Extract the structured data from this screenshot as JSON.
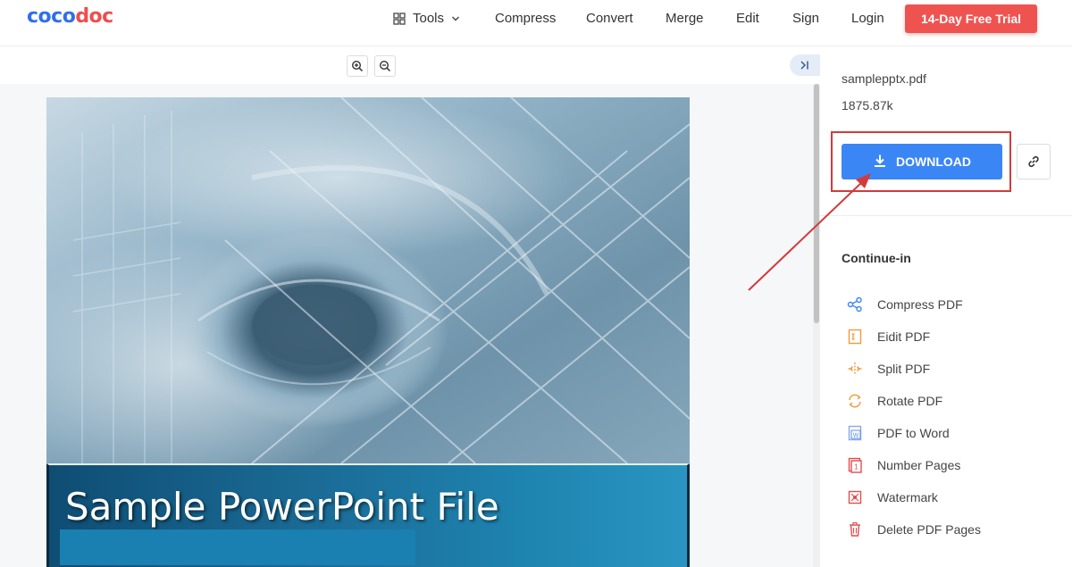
{
  "header": {
    "logo_part1": "coco",
    "logo_part2": "doc",
    "nav": {
      "tools": "Tools",
      "compress": "Compress",
      "convert": "Convert",
      "merge": "Merge",
      "edit": "Edit",
      "sign": "Sign",
      "login": "Login"
    },
    "trial_button": "14-Day Free Trial"
  },
  "slide": {
    "title": "Sample PowerPoint File"
  },
  "panel": {
    "file_name": "samplepptx.pdf",
    "file_size": "1875.87k",
    "download_label": "DOWNLOAD",
    "continue_title": "Continue-in",
    "tools": [
      {
        "label": "Compress PDF",
        "icon": "share-icon",
        "color": "#3b86f5"
      },
      {
        "label": "Eidit PDF",
        "icon": "edit-icon",
        "color": "#f29a3e"
      },
      {
        "label": "Split PDF",
        "icon": "split-icon",
        "color": "#f29a3e"
      },
      {
        "label": "Rotate PDF",
        "icon": "rotate-icon",
        "color": "#f29a3e"
      },
      {
        "label": "PDF to Word",
        "icon": "word-icon",
        "color": "#5b8def"
      },
      {
        "label": "Number Pages",
        "icon": "number-pages-icon",
        "color": "#e04e4e"
      },
      {
        "label": "Watermark",
        "icon": "watermark-icon",
        "color": "#e04e4e"
      },
      {
        "label": "Delete PDF Pages",
        "icon": "delete-icon",
        "color": "#e04e4e"
      }
    ]
  },
  "colors": {
    "brand_blue": "#2f6fed",
    "brand_red": "#ef4d4d",
    "download_blue": "#3b86f5",
    "trial_red": "#ef5350",
    "annotation_red": "#d23b3b"
  }
}
